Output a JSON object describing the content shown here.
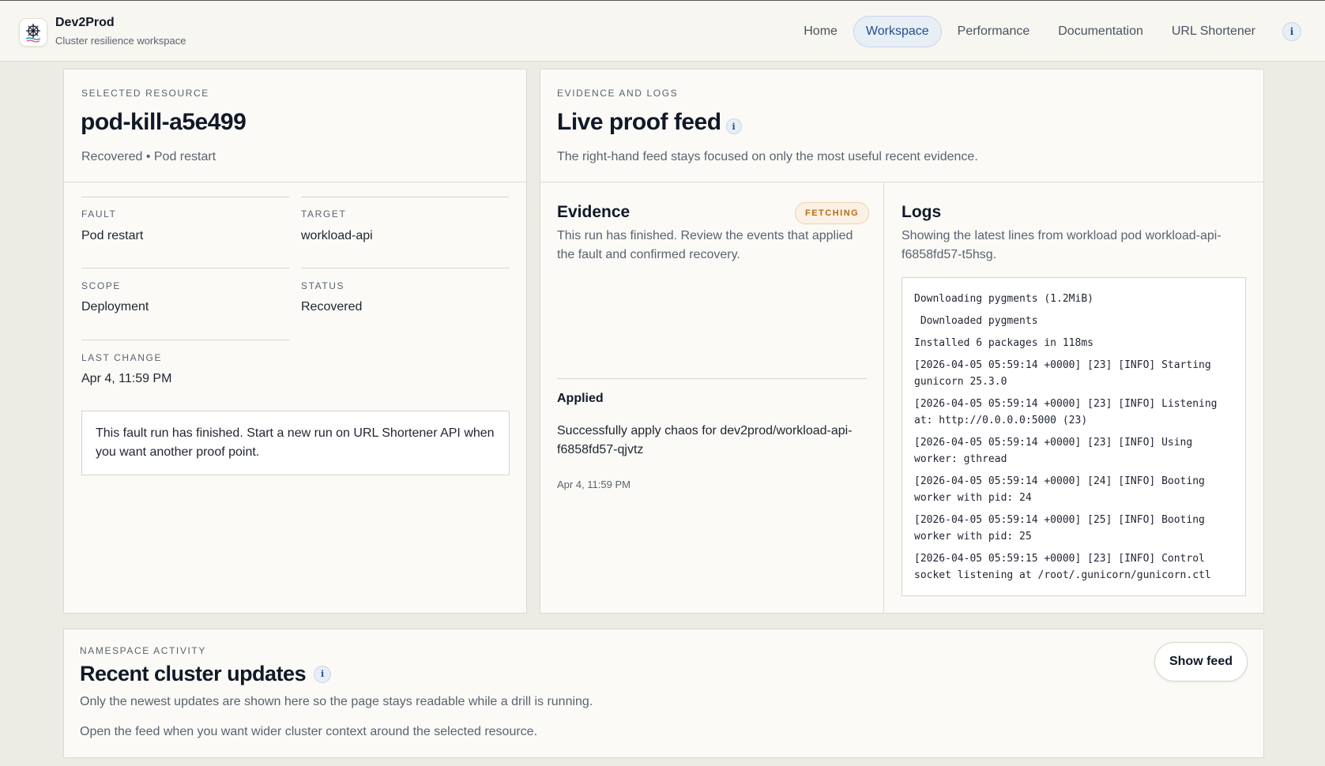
{
  "brand": {
    "name": "Dev2Prod",
    "subtitle": "Cluster resilience workspace",
    "logo_icon": "ship-wheel-icon"
  },
  "nav": {
    "items": [
      {
        "label": "Home",
        "active": false
      },
      {
        "label": "Workspace",
        "active": true
      },
      {
        "label": "Performance",
        "active": false
      },
      {
        "label": "Documentation",
        "active": false
      },
      {
        "label": "URL Shortener",
        "active": false
      }
    ],
    "info": "i"
  },
  "resource": {
    "eyebrow": "SELECTED RESOURCE",
    "title": "pod-kill-a5e499",
    "subtitle": "Recovered • Pod restart",
    "fields": {
      "fault_label": "FAULT",
      "fault_value": "Pod restart",
      "target_label": "TARGET",
      "target_value": "workload-api",
      "scope_label": "SCOPE",
      "scope_value": "Deployment",
      "status_label": "STATUS",
      "status_value": "Recovered",
      "last_change_label": "LAST CHANGE",
      "last_change_value": "Apr 4, 11:59 PM"
    },
    "note": "This fault run has finished. Start a new run on URL Shortener API when you want another proof point."
  },
  "evidence_logs": {
    "eyebrow": "EVIDENCE AND LOGS",
    "title": "Live proof feed",
    "info": "i",
    "description": "The right-hand feed stays focused on only the most useful recent evidence.",
    "evidence": {
      "title": "Evidence",
      "badge": "FETCHING",
      "description": "This run has finished. Review the events that applied the fault and confirmed recovery.",
      "event_title": "Applied",
      "event_text": "Successfully apply chaos for dev2prod/workload-api-f6858fd57-qjvtz",
      "event_time": "Apr 4, 11:59 PM"
    },
    "logs": {
      "title": "Logs",
      "description": "Showing the latest lines from workload pod workload-api-f6858fd57-t5hsg.",
      "lines": [
        "Downloading pygments (1.2MiB)",
        " Downloaded pygments",
        "Installed 6 packages in 118ms",
        "[2026-04-05 05:59:14 +0000] [23] [INFO] Starting gunicorn 25.3.0",
        "[2026-04-05 05:59:14 +0000] [23] [INFO] Listening at: http://0.0.0.0:5000 (23)",
        "[2026-04-05 05:59:14 +0000] [23] [INFO] Using worker: gthread",
        "[2026-04-05 05:59:14 +0000] [24] [INFO] Booting worker with pid: 24",
        "[2026-04-05 05:59:14 +0000] [25] [INFO] Booting worker with pid: 25",
        "[2026-04-05 05:59:15 +0000] [23] [INFO] Control socket listening at /root/.gunicorn/gunicorn.ctl"
      ]
    }
  },
  "activity": {
    "eyebrow": "NAMESPACE ACTIVITY",
    "title": "Recent cluster updates",
    "info": "i",
    "line1": "Only the newest updates are shown here so the page stays readable while a drill is running.",
    "line2": "Open the feed when you want wider cluster context around the selected resource.",
    "button": "Show feed"
  },
  "colors": {
    "accent": "#1f4f8a",
    "accent_bg": "#e8eef6",
    "badge_text": "#b86a17",
    "badge_bg": "#fbf1e4",
    "page_bg": "#ecebe4",
    "panel_bg": "#fbfaf6"
  }
}
